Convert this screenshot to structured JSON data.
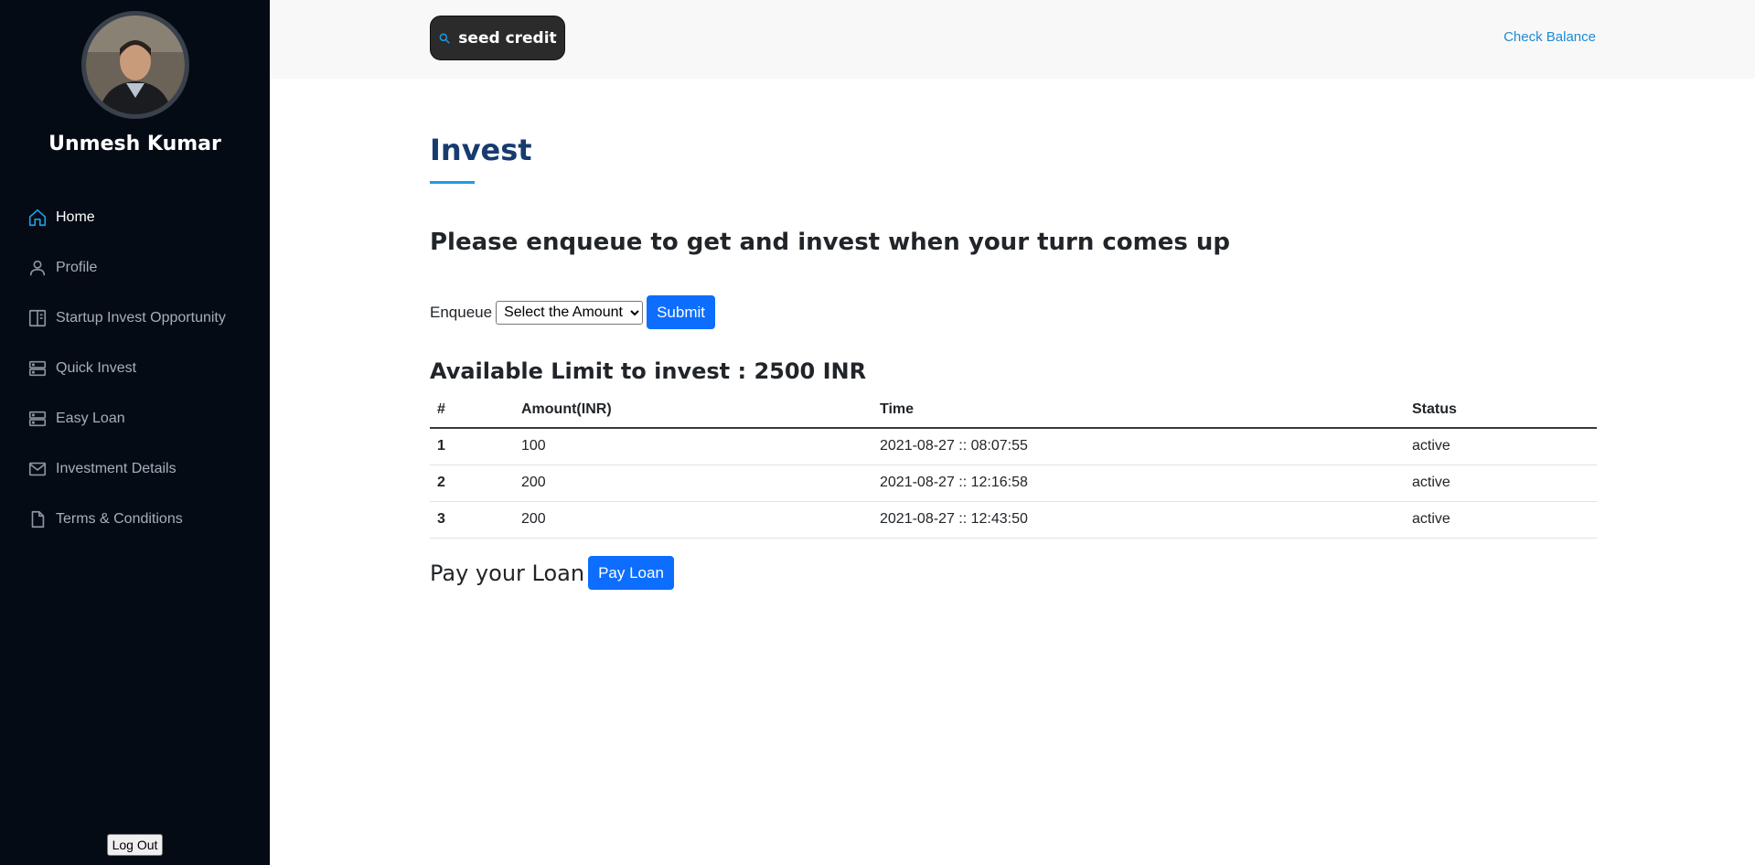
{
  "user": {
    "name": "Unmesh Kumar"
  },
  "sidebar": {
    "items": [
      {
        "label": "Home",
        "icon": "home-icon"
      },
      {
        "label": "Profile",
        "icon": "user-icon"
      },
      {
        "label": "Startup Invest Opportunity",
        "icon": "layout-icon"
      },
      {
        "label": "Quick Invest",
        "icon": "server-icon"
      },
      {
        "label": "Easy Loan",
        "icon": "server-icon"
      },
      {
        "label": "Investment Details",
        "icon": "mail-icon"
      },
      {
        "label": "Terms & Conditions",
        "icon": "file-icon"
      }
    ],
    "logout_label": "Log Out"
  },
  "topbar": {
    "brand": "seed credit",
    "check_balance": "Check Balance"
  },
  "main": {
    "title": "Invest",
    "prompt": "Please enqueue to get and invest when your turn comes up",
    "enqueue_label": "Enqueue",
    "select_value": "Select the Amount",
    "submit_label": "Submit",
    "limit_text": "Available Limit to invest : 2500 INR",
    "table": {
      "headers": [
        "#",
        "Amount(INR)",
        "Time",
        "Status"
      ],
      "rows": [
        [
          "1",
          "100",
          "2021-08-27 :: 08:07:55",
          "active"
        ],
        [
          "2",
          "200",
          "2021-08-27 :: 12:16:58",
          "active"
        ],
        [
          "3",
          "200",
          "2021-08-27 :: 12:43:50",
          "active"
        ]
      ]
    },
    "loan_label": "Pay your Loan",
    "pay_loan_label": "Pay Loan"
  },
  "colors": {
    "sidebar_bg": "#050b14",
    "accent": "#1e9be6",
    "title": "#173b6e",
    "primary_button": "#0d6efd"
  }
}
